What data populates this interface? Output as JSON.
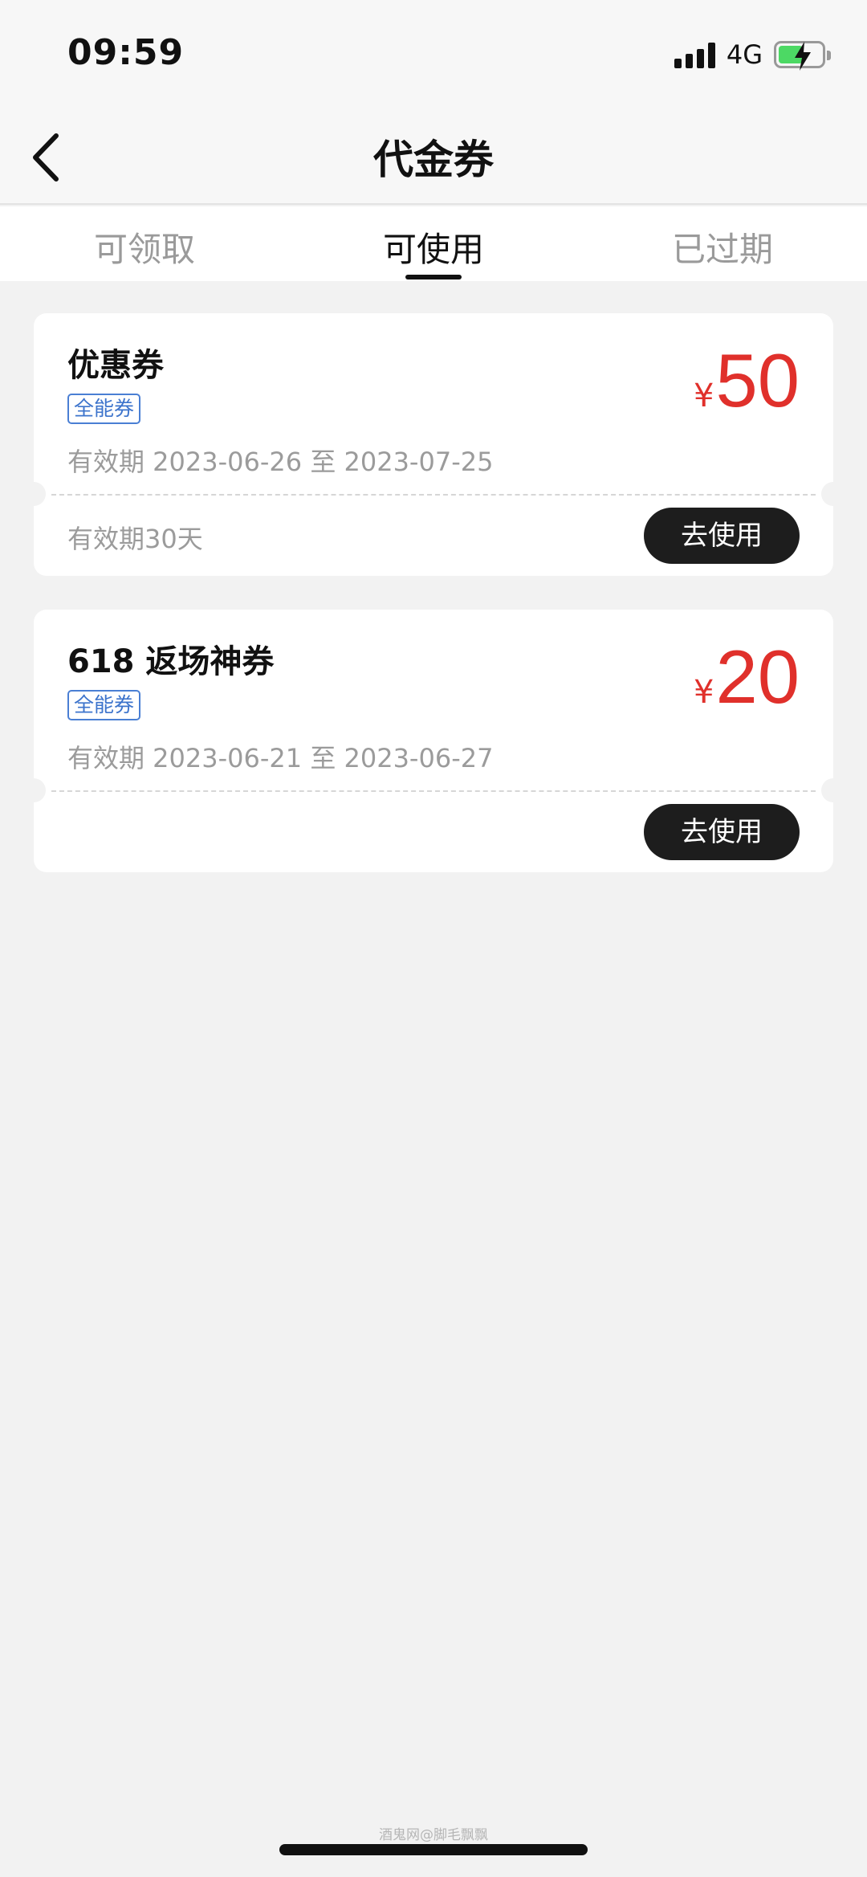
{
  "status_bar": {
    "time": "09:59",
    "network": "4G",
    "icons": [
      "signal-icon",
      "battery-charging-icon"
    ]
  },
  "nav": {
    "title": "代金券",
    "back_icon": "chevron-left-icon"
  },
  "tabs": [
    {
      "label": "可领取",
      "active": false
    },
    {
      "label": "可使用",
      "active": true
    },
    {
      "label": "已过期",
      "active": false
    }
  ],
  "coupons": [
    {
      "title": "优惠券",
      "tag": "全能券",
      "validity": "有效期 2023-06-26 至 2023-07-25",
      "currency": "¥",
      "amount": "50",
      "footer_note": "有效期30天",
      "button": "去使用"
    },
    {
      "title": "618 返场神券",
      "tag": "全能券",
      "validity": "有效期 2023-06-21 至 2023-06-27",
      "currency": "¥",
      "amount": "20",
      "footer_note": "",
      "button": "去使用"
    }
  ],
  "watermark": "酒鬼网@脚毛飘飘",
  "colors": {
    "accent_red": "#e0302b",
    "tag_blue": "#3d74cc",
    "button_dark": "#1d1d1d"
  }
}
